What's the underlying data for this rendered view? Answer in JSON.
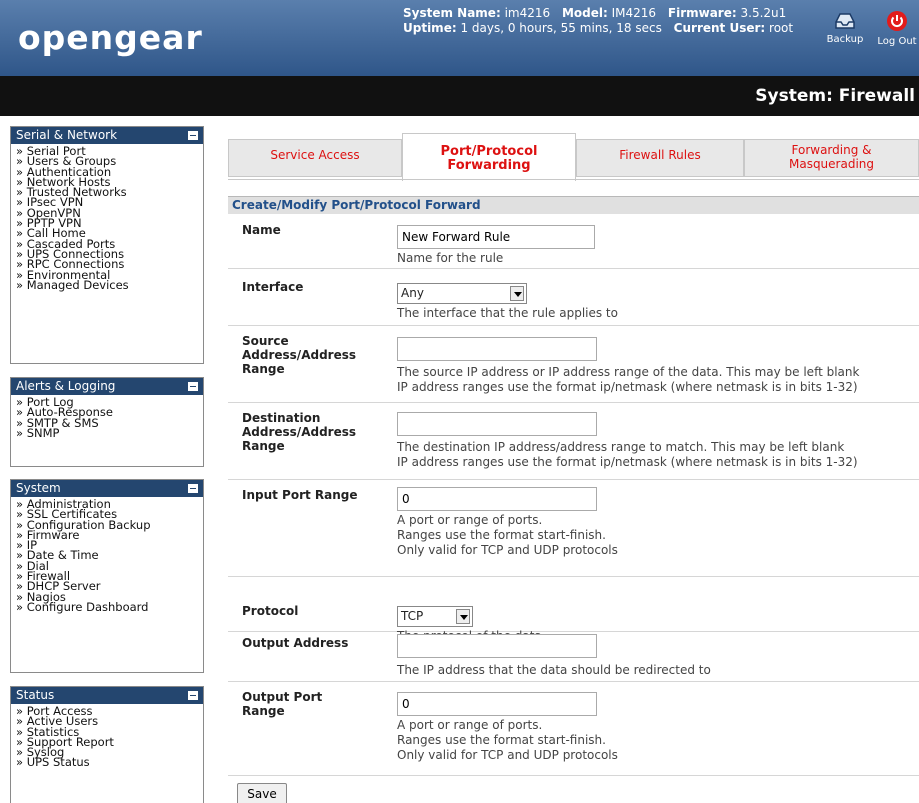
{
  "header": {
    "logo": "opengear",
    "system_name_label": "System Name:",
    "system_name": "im4216",
    "model_label": "Model:",
    "model": "IM4216",
    "firmware_label": "Firmware:",
    "firmware": "3.5.2u1",
    "uptime_label": "Uptime:",
    "uptime": "1 days, 0 hours, 55 mins, 18 secs",
    "current_user_label": "Current User:",
    "current_user": "root",
    "backup_label": "Backup",
    "logout_label": "Log Out"
  },
  "page_title": "System: Firewall",
  "sidebar": [
    {
      "title": "Serial & Network",
      "items": [
        "Serial Port",
        "Users & Groups",
        "Authentication",
        "Network Hosts",
        "Trusted Networks",
        "IPsec VPN",
        "OpenVPN",
        "PPTP VPN",
        "Call Home",
        "Cascaded Ports",
        "UPS Connections",
        "RPC Connections",
        "Environmental",
        "Managed Devices"
      ]
    },
    {
      "title": "Alerts & Logging",
      "items": [
        "Port Log",
        "Auto-Response",
        "SMTP & SMS",
        "SNMP"
      ]
    },
    {
      "title": "System",
      "items": [
        "Administration",
        "SSL Certificates",
        "Configuration Backup",
        "Firmware",
        "IP",
        "Date & Time",
        "Dial",
        "Firewall",
        "DHCP Server",
        "Nagios",
        "Configure Dashboard"
      ]
    },
    {
      "title": "Status",
      "items": [
        "Port Access",
        "Active Users",
        "Statistics",
        "Support Report",
        "Syslog",
        "UPS Status"
      ]
    }
  ],
  "tabs": [
    {
      "label": "Service Access"
    },
    {
      "label": "Port/Protocol Forwarding"
    },
    {
      "label": "Firewall Rules"
    },
    {
      "label": "Forwarding & Masquerading"
    }
  ],
  "form": {
    "section_title": "Create/Modify Port/Protocol Forward",
    "name": {
      "label": "Name",
      "value": "New Forward Rule",
      "help": "Name for the rule"
    },
    "interface": {
      "label": "Interface",
      "value": "Any",
      "help": "The interface that the rule applies to"
    },
    "source": {
      "label": "Source Address/Address Range",
      "value": "",
      "help1": "The source IP address or IP address range of the data. This may be left blank",
      "help2": "IP address ranges use the format ip/netmask (where netmask is in bits 1-32)"
    },
    "destination": {
      "label": "Destination Address/Address Range",
      "value": "",
      "help1": "The destination IP address/address range to match. This may be left blank",
      "help2": "IP address ranges use the format ip/netmask (where netmask is in bits 1-32)"
    },
    "input_port": {
      "label": "Input Port Range",
      "value": "0",
      "help1": "A port or range of ports.",
      "help2": "Ranges use the format start-finish.",
      "help3": "Only valid for TCP and UDP protocols"
    },
    "protocol": {
      "label": "Protocol",
      "value": "TCP",
      "help": "The protocol of the data"
    },
    "output_address": {
      "label": "Output Address",
      "value": "",
      "help": "The IP address that the data should be redirected to"
    },
    "output_port": {
      "label": "Output Port Range",
      "value": "0",
      "help1": "A port or range of ports.",
      "help2": "Ranges use the format start-finish.",
      "help3": "Only valid for TCP and UDP protocols"
    },
    "save_label": "Save"
  },
  "colors": {
    "header": "#2f5689",
    "sidebar_head": "#24466f",
    "tab_text": "#dd1111",
    "section_title": "#22508a"
  }
}
